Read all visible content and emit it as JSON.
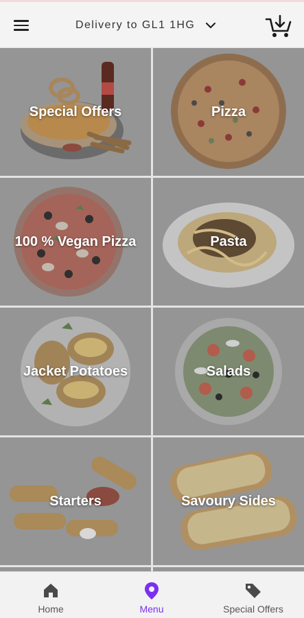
{
  "header": {
    "delivery_label": "Delivery to GL1 1HG",
    "menu_icon": "hamburger-icon",
    "dropdown_icon": "chevron-down-icon",
    "cart_icon": "cart-download-icon"
  },
  "categories": [
    {
      "label": "Special Offers",
      "image": "combo-meal"
    },
    {
      "label": "Pizza",
      "image": "pizza"
    },
    {
      "label": "100 % Vegan Pizza",
      "image": "vegan-pizza"
    },
    {
      "label": "Pasta",
      "image": "pasta-plate"
    },
    {
      "label": "Jacket Potatoes",
      "image": "jacket-potatoes"
    },
    {
      "label": "Salads",
      "image": "salad-bowl"
    },
    {
      "label": "Starters",
      "image": "mozzarella-sticks"
    },
    {
      "label": "Savoury Sides",
      "image": "garlic-bread"
    }
  ],
  "bottom_nav": {
    "items": [
      {
        "label": "Home",
        "icon": "home-icon",
        "active": false
      },
      {
        "label": "Menu",
        "icon": "map-pin-icon",
        "active": true
      },
      {
        "label": "Special Offers",
        "icon": "tag-icon",
        "active": false
      }
    ],
    "active_color": "#7b2ff2",
    "inactive_color": "#555555"
  },
  "colors": {
    "tile_overlay": "#959595",
    "header_bg": "#f4f4f4"
  }
}
